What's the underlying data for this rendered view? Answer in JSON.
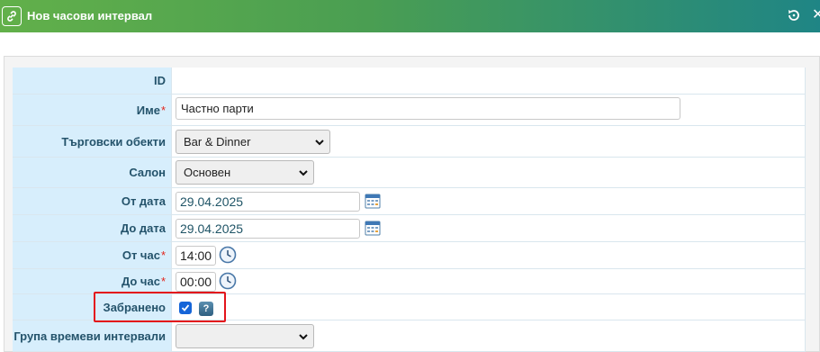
{
  "window": {
    "title": "Нов часови интервал"
  },
  "form": {
    "id": {
      "label": "ID",
      "value": ""
    },
    "name": {
      "label": "Име",
      "required": "*",
      "value": "Частно парти"
    },
    "outlets": {
      "label": "Търговски обекти",
      "selected": "Bar & Dinner"
    },
    "hall": {
      "label": "Салон",
      "selected": "Основен"
    },
    "from_date": {
      "label": "От дата",
      "value": "29.04.2025"
    },
    "to_date": {
      "label": "До дата",
      "value": "29.04.2025"
    },
    "from_hour": {
      "label": "От час",
      "required": "*",
      "value": "14:00"
    },
    "to_hour": {
      "label": "До час",
      "required": "*",
      "value": "00:00"
    },
    "forbidden": {
      "label": "Забранено",
      "checked": true,
      "help": "?"
    },
    "group": {
      "label": "Група времеви интервали",
      "selected": ""
    }
  },
  "colors": {
    "title_gradient_start": "#62b04a",
    "title_gradient_end": "#1f8585",
    "label_bg": "#d7eefc",
    "label_text": "#24536b",
    "required": "#e3241b",
    "highlight": "#e3141b",
    "checkbox": "#1565d8"
  },
  "icons": {
    "title": "link-icon",
    "reset": "reset-icon",
    "close": "close-icon",
    "calendar": "calendar-icon",
    "clock": "clock-icon",
    "help": "help-icon",
    "dropdown": "chevron-down-icon"
  }
}
